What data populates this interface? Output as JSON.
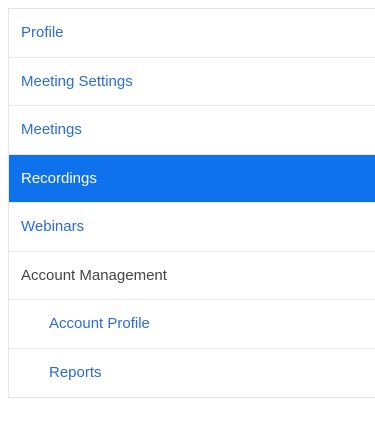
{
  "nav": {
    "items": [
      {
        "label": "Profile"
      },
      {
        "label": "Meeting Settings"
      },
      {
        "label": "Meetings"
      },
      {
        "label": "Recordings"
      },
      {
        "label": "Webinars"
      },
      {
        "label": "Account Management"
      },
      {
        "label": "Account Profile"
      },
      {
        "label": "Reports"
      }
    ]
  },
  "colors": {
    "accent": "#0e72ed",
    "link": "#2d6bd6",
    "section_text": "#444444"
  }
}
